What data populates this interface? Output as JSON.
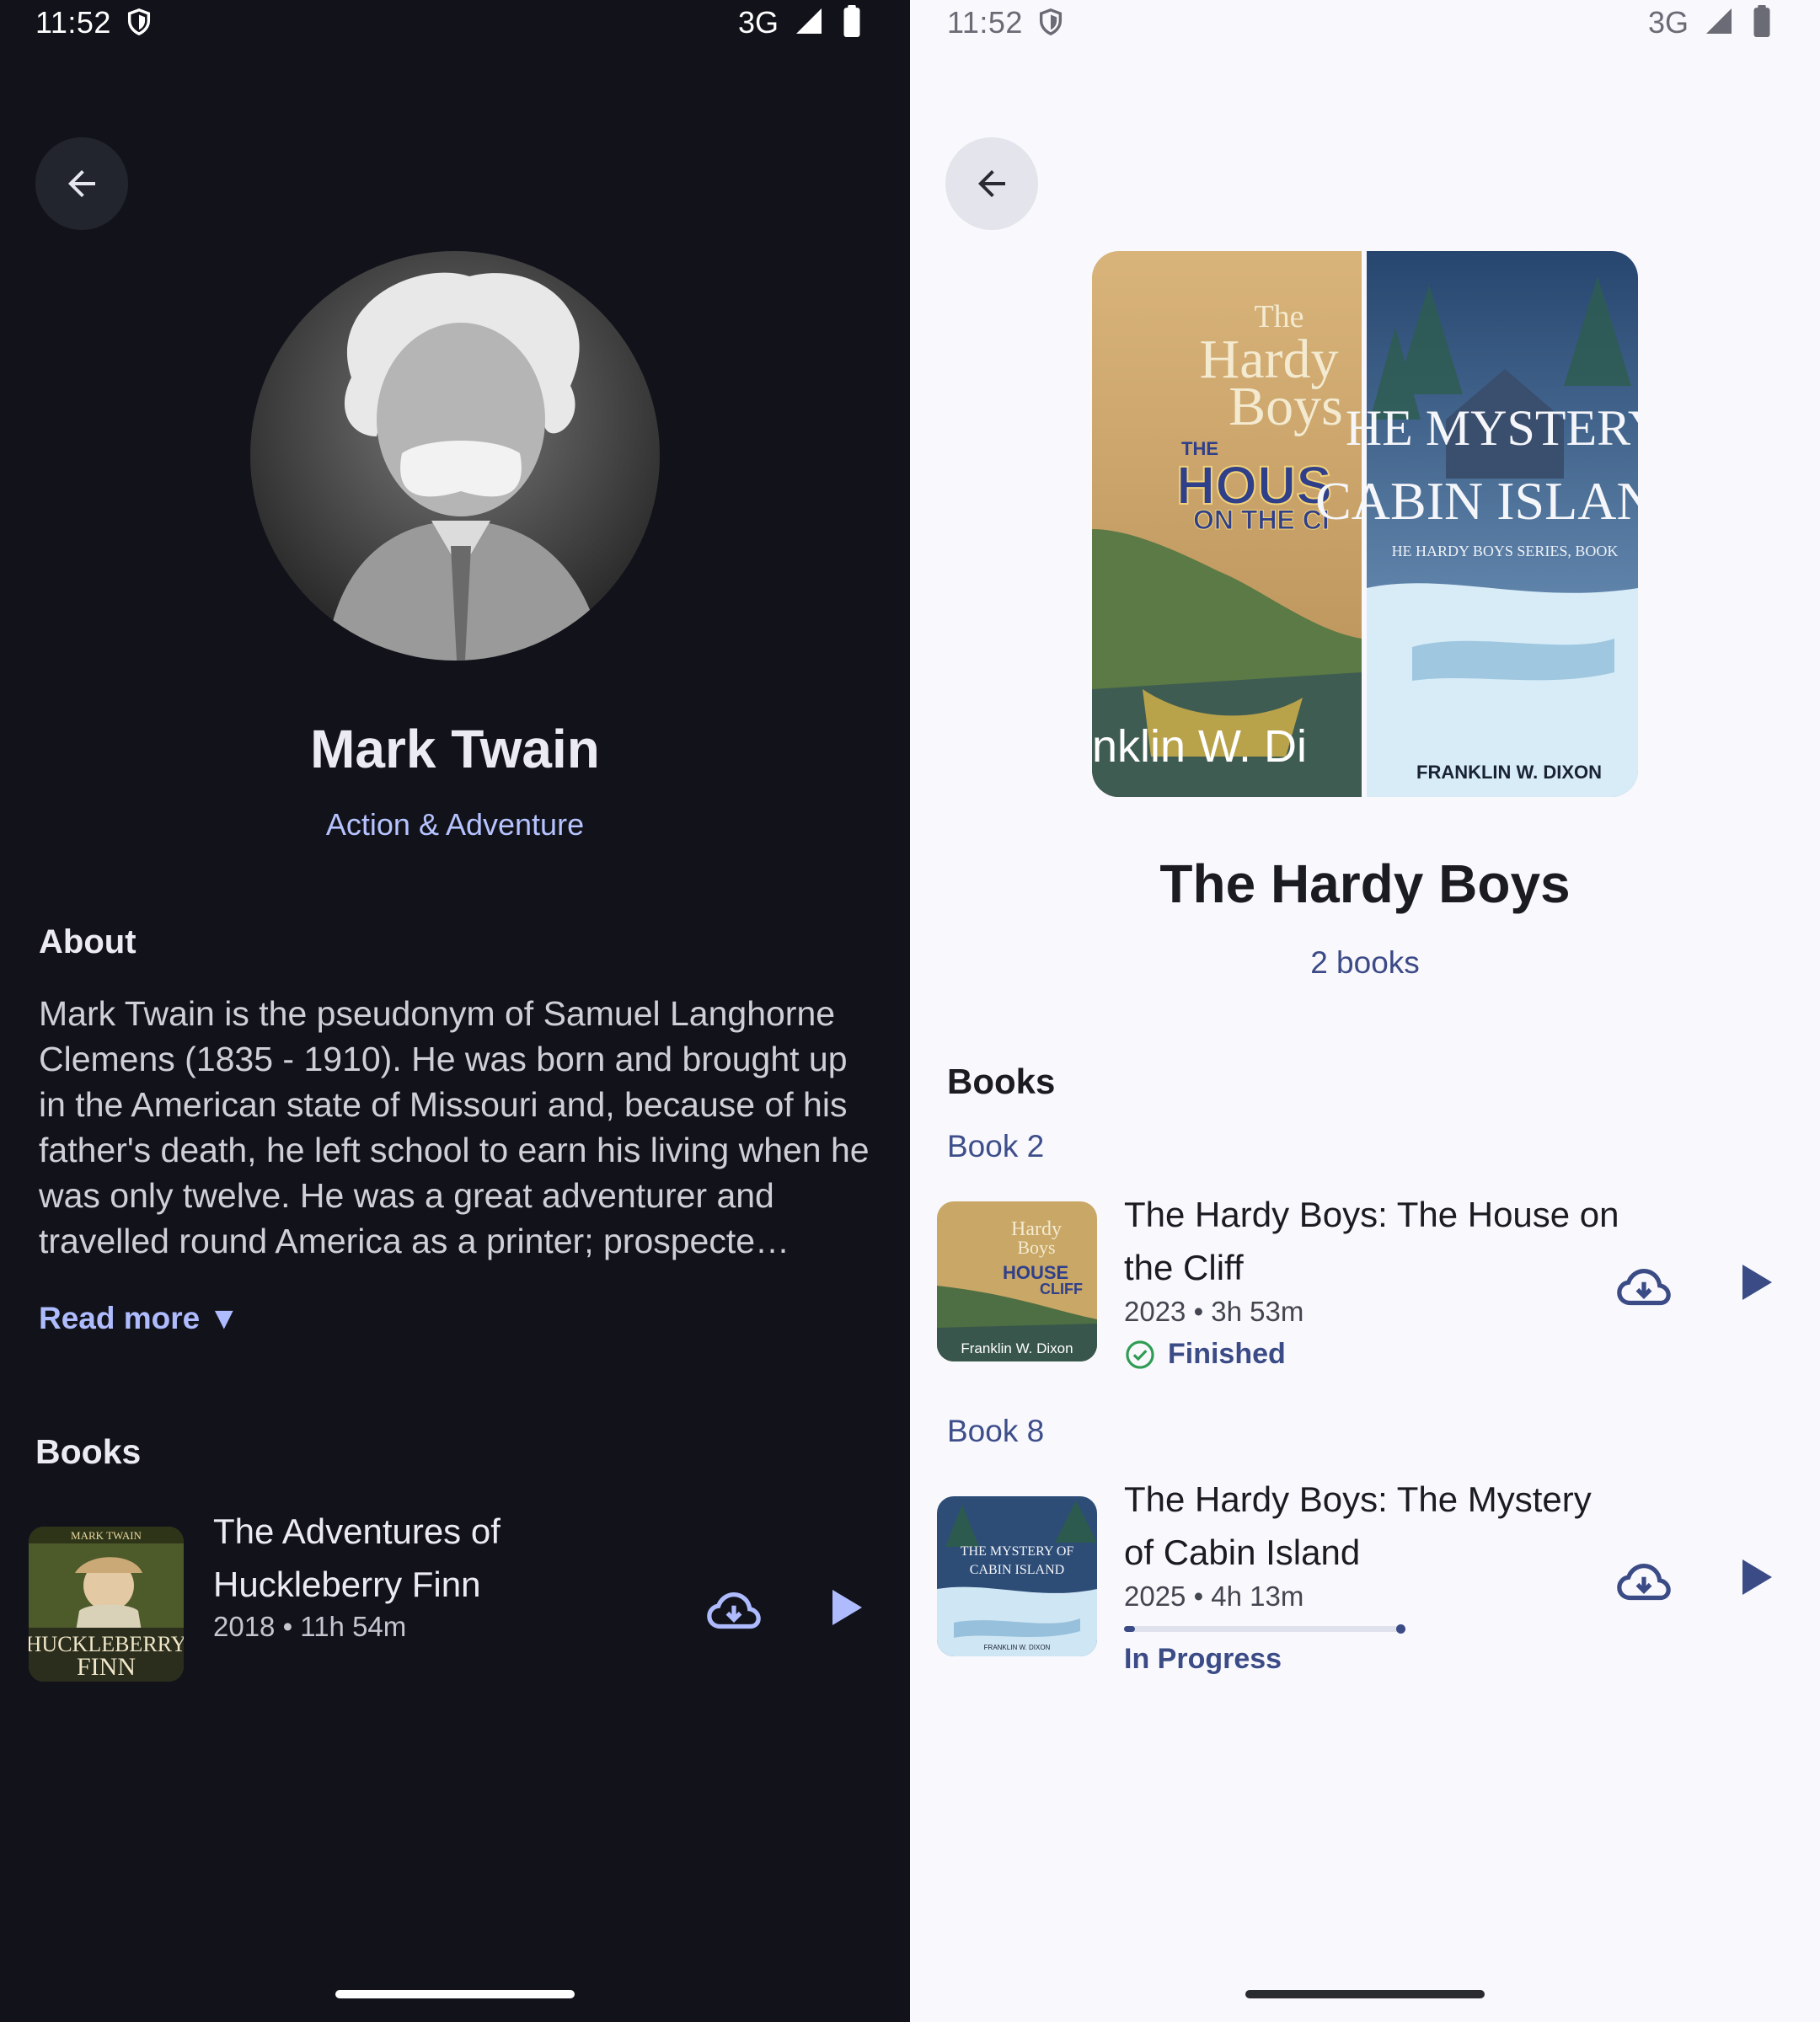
{
  "status_bar": {
    "time": "11:52",
    "network": "3G"
  },
  "author": {
    "name": "Mark Twain",
    "genre": "Action & Adventure",
    "about_heading": "About",
    "about_text": "Mark Twain is the pseudonym of Samuel Langhorne Clemens (1835 - 1910). He was born and brought up in the American state of Missouri and, because of his father's death, he left school to earn his living when he was only twelve. He was a great adventurer and travelled round America as a printer; prospecte…",
    "read_more": "Read more ▼",
    "books_heading": "Books",
    "books": [
      {
        "title": "The Adventures of Huckleberry Finn",
        "meta": "2018  •  11h 54m",
        "cover_text_top": "MARK TWAIN",
        "cover_text_main": "HUCKLEBERRY",
        "cover_text_sub": "FINN"
      }
    ]
  },
  "series": {
    "name": "The Hardy Boys",
    "count": "2 books",
    "books_heading": "Books",
    "cover_left": {
      "line1": "The",
      "line2": "Hardy",
      "line3": "Boys",
      "line4": "THE",
      "line5": "HOUS",
      "line6": "ON THE CI",
      "author": "nklin W. Di"
    },
    "cover_right": {
      "line1": "HE MYSTERY",
      "line2": "CABIN ISLAND",
      "line3": "HE HARDY BOYS SERIES, BOOK",
      "author": "FRANKLIN W. DIXON"
    },
    "items": [
      {
        "book_number": "Book 2",
        "title": "The Hardy Boys: The House on the Cliff",
        "meta": "2023  •  3h 53m",
        "status": "Finished",
        "cover_text_a": "Hardy",
        "cover_text_b": "Boys",
        "cover_text_c": "HOUSE",
        "cover_text_d": "CLIFF",
        "cover_author": "Franklin W. Dixon"
      },
      {
        "book_number": "Book 8",
        "title": "The Hardy Boys: The Mystery of Cabin Island",
        "meta": "2025  •  4h 13m",
        "progress": 0.04,
        "status": "In Progress",
        "cover_text_a": "THE MYSTERY OF",
        "cover_text_b": "CABIN ISLAND",
        "cover_author": "FRANKLIN W. DIXON"
      }
    ]
  },
  "colors": {
    "dark_bg": "#12131a",
    "light_bg": "#f8f8fd",
    "accent_dark": "#aebcff",
    "accent_light": "#3b4b86",
    "finished_green": "#2e9c52"
  },
  "icons": {
    "back": "arrow-left-icon",
    "download": "cloud-download-icon",
    "play": "play-icon",
    "finished": "check-circle-icon",
    "shield": "shield-icon",
    "signal": "signal-icon",
    "battery": "battery-icon"
  }
}
